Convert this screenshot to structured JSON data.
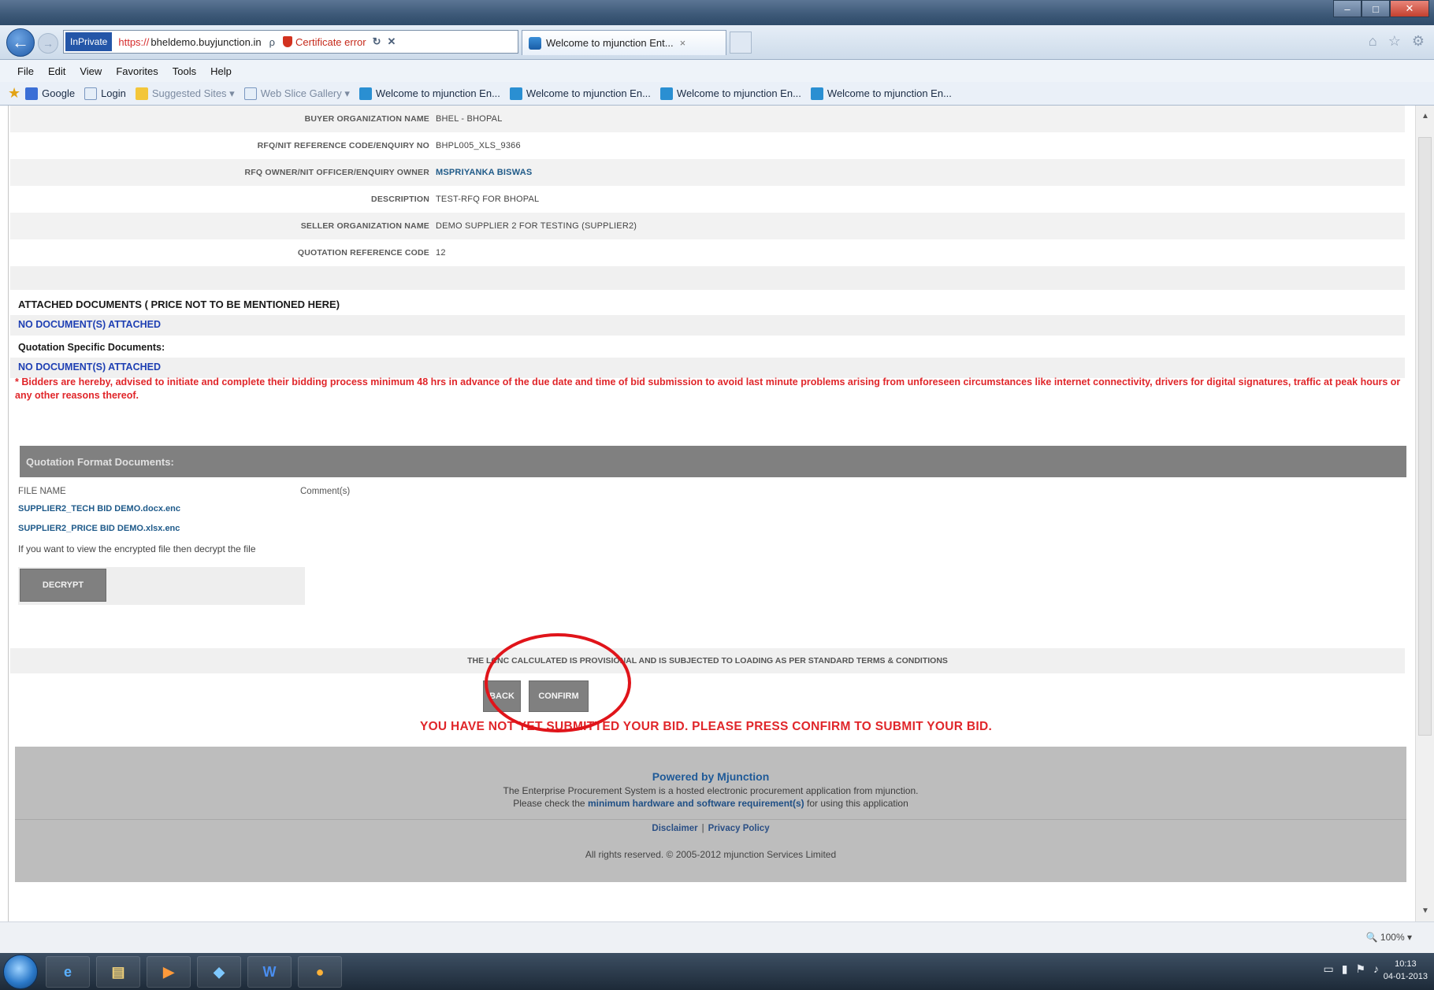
{
  "browser": {
    "inprivate_label": "InPrivate",
    "url_protocol": "https://",
    "url_host": "bheldemo.buyjunction.in",
    "url_search_glyph": "ρ",
    "cert_error": "Certificate error",
    "active_tab": "Welcome to mjunction Ent...",
    "menu": [
      "File",
      "Edit",
      "View",
      "Favorites",
      "Tools",
      "Help"
    ],
    "favorites": {
      "google": "Google",
      "login": "Login",
      "suggested": "Suggested Sites ▾",
      "webslice": "Web Slice Gallery ▾",
      "mj1": "Welcome to mjunction En...",
      "mj2": "Welcome to mjunction En...",
      "mj3": "Welcome to mjunction En...",
      "mj4": "Welcome to mjunction En..."
    },
    "zoom": "100%"
  },
  "details": {
    "rows": [
      {
        "label": "BUYER ORGANIZATION NAME",
        "value": "BHEL - BHOPAL"
      },
      {
        "label": "RFQ/NIT REFERENCE CODE/ENQUIRY NO",
        "value": "BHPL005_XLS_9366"
      },
      {
        "label": "RFQ OWNER/NIT OFFICER/ENQUIRY OWNER",
        "value": "MSPRIYANKA BISWAS"
      },
      {
        "label": "DESCRIPTION",
        "value": "TEST-RFQ FOR BHOPAL"
      },
      {
        "label": "SELLER ORGANIZATION NAME",
        "value": "DEMO SUPPLIER 2 FOR TESTING (SUPPLIER2)"
      },
      {
        "label": "QUOTATION REFERENCE CODE",
        "value": "12"
      }
    ]
  },
  "attachments": {
    "title": "ATTACHED DOCUMENTS ( PRICE NOT TO BE MENTIONED HERE)",
    "none_1": "NO DOCUMENT(S) ATTACHED",
    "quotation_specific": "Quotation Specific Documents:",
    "none_2": "NO DOCUMENT(S) ATTACHED",
    "warning": "* Bidders are hereby, advised to initiate and complete their bidding process minimum 48 hrs in advance of the due date and time of bid submission to avoid last minute problems arising from unforeseen circumstances like internet connectivity, drivers for digital signatures, traffic at peak hours or any other reasons thereof."
  },
  "qfd": {
    "header": "Quotation Format Documents:",
    "col_file": "FILE NAME",
    "col_comments": "Comment(s)",
    "files": [
      "SUPPLIER2_TECH BID DEMO.docx.enc",
      "SUPPLIER2_PRICE BID DEMO.xlsx.enc"
    ],
    "decrypt_hint": "If you want to view the encrypted file then decrypt the file",
    "decrypt_button": "DECRYPT"
  },
  "submit": {
    "lcnc_note": "THE LCNC CALCULATED IS PROVISIONAL AND IS SUBJECTED TO LOADING AS PER STANDARD TERMS & CONDITIONS",
    "back_button": "BACK",
    "confirm_button": "CONFIRM",
    "not_submitted": "YOU HAVE NOT YET SUBMITTED YOUR BID. PLEASE PRESS CONFIRM TO SUBMIT YOUR BID."
  },
  "footer": {
    "powered": "Powered by Mjunction",
    "description": "The Enterprise Procurement System is a hosted electronic procurement application from mjunction.",
    "req_prefix": "Please check the ",
    "req_link": "minimum hardware and software requirement(s)",
    "req_suffix": " for using this application",
    "disclaimer": "Disclaimer",
    "privacy": "Privacy Policy",
    "copyright": "All rights reserved. © 2005-2012 mjunction Services Limited"
  },
  "taskbar": {
    "time": "10:13",
    "date": "04-01-2013",
    "word_glyph": "W"
  },
  "colors": {
    "link_blue": "#1f5a88",
    "warning_red": "#e0262a",
    "button_gray": "#808080"
  }
}
